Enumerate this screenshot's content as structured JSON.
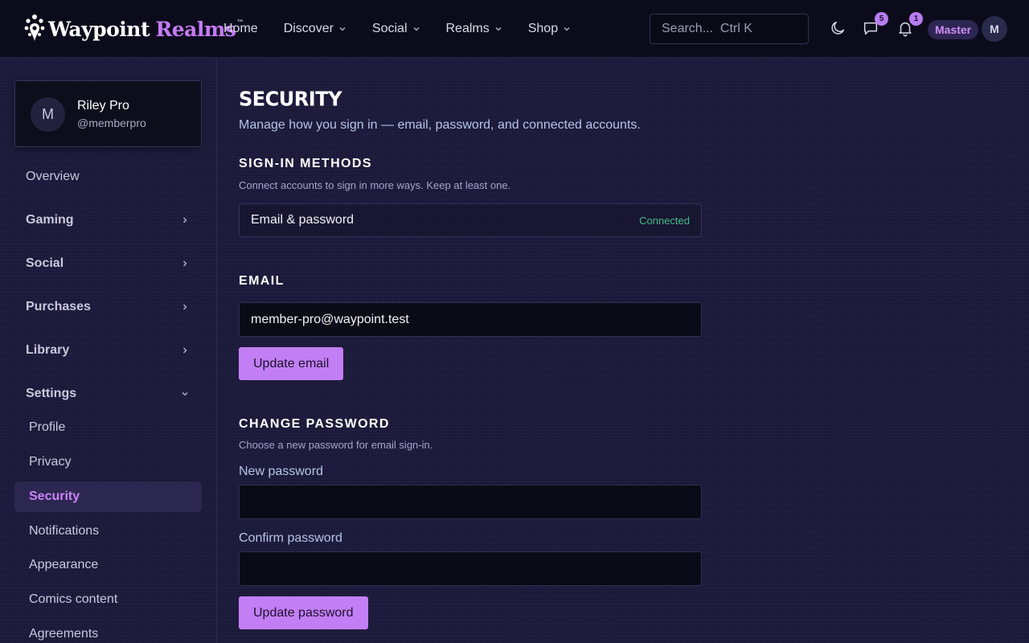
{
  "brand": {
    "name_part1": "Waypoint",
    "name_part2": "Realms",
    "trademark": "™",
    "accent_color": "#c57bf5"
  },
  "nav": {
    "items": [
      {
        "label": "Home",
        "has_dropdown": false
      },
      {
        "label": "Discover",
        "has_dropdown": true
      },
      {
        "label": "Social",
        "has_dropdown": true
      },
      {
        "label": "Realms",
        "has_dropdown": true
      },
      {
        "label": "Shop",
        "has_dropdown": true
      }
    ]
  },
  "header": {
    "search_placeholder": "Search...  Ctrl K",
    "theme_icon": "moon-icon",
    "messages_icon": "chat-icon",
    "messages_count": "5",
    "notifications_icon": "bell-icon",
    "notifications_count": "1",
    "role_badge": "Master",
    "avatar_initial": "M"
  },
  "sidebar": {
    "profile": {
      "initial": "M",
      "name": "Riley Pro",
      "handle": "@memberpro"
    },
    "overview": "Overview",
    "groups": [
      {
        "label": "Gaming",
        "expanded": false
      },
      {
        "label": "Social",
        "expanded": false
      },
      {
        "label": "Purchases",
        "expanded": false
      },
      {
        "label": "Library",
        "expanded": false
      },
      {
        "label": "Settings",
        "expanded": true
      }
    ],
    "settings_items": [
      {
        "label": "Profile",
        "active": false
      },
      {
        "label": "Privacy",
        "active": false
      },
      {
        "label": "Security",
        "active": true
      },
      {
        "label": "Notifications",
        "active": false
      },
      {
        "label": "Appearance",
        "active": false
      },
      {
        "label": "Comics content",
        "active": false
      },
      {
        "label": "Agreements",
        "active": false
      }
    ]
  },
  "main": {
    "title": "SECURITY",
    "subtitle": "Manage how you sign in — email, password, and connected accounts.",
    "signin": {
      "title": "SIGN-IN METHODS",
      "subtitle": "Connect accounts to sign in more ways. Keep at least one.",
      "methods": [
        {
          "name": "Email & password",
          "status": "Connected",
          "status_color": "#3fbb8c"
        }
      ]
    },
    "email": {
      "title": "EMAIL",
      "value": "member-pro@waypoint.test",
      "button": "Update email"
    },
    "password": {
      "title": "CHANGE PASSWORD",
      "subtitle": "Choose a new password for email sign-in.",
      "new_label": "New password",
      "new_value": "",
      "confirm_label": "Confirm password",
      "confirm_value": "",
      "button": "Update password"
    }
  }
}
